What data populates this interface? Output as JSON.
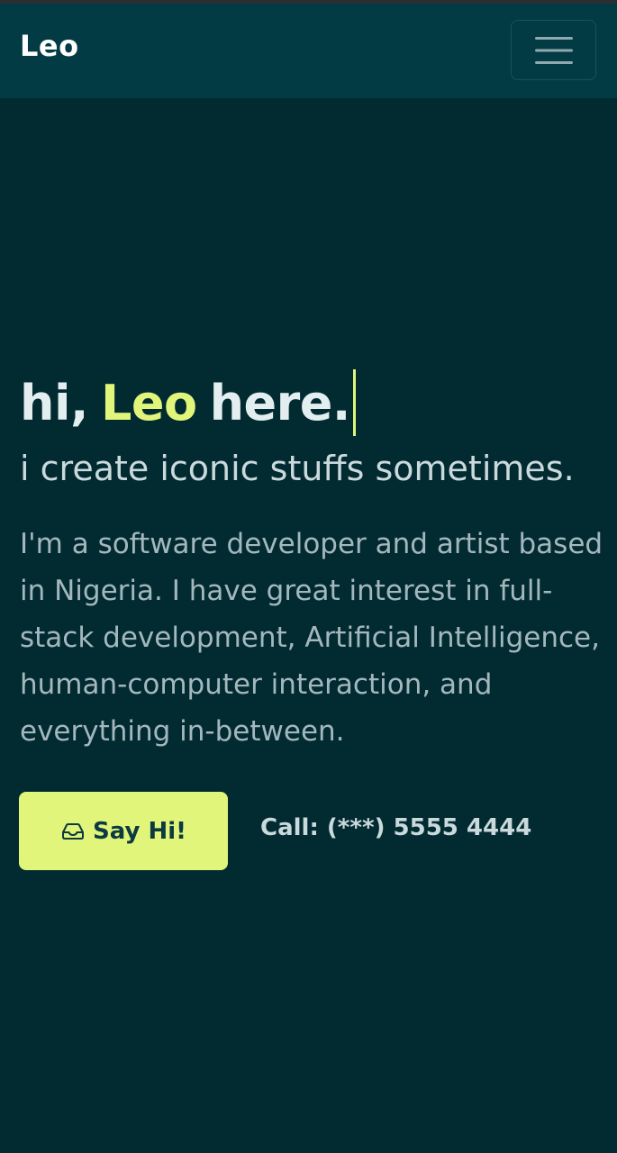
{
  "header": {
    "brand": "Leo",
    "menu_icon": "hamburger-menu-icon"
  },
  "hero": {
    "greeting_prefix": "hi,",
    "greeting_name": "Leo",
    "greeting_suffix": "here.",
    "subtitle": "i create iconic stuffs sometimes.",
    "bio": "I'm a software developer and artist based in Nigeria. I have great interest in full-stack development, Artificial Intelligence, human-computer interaction, and everything in-between."
  },
  "actions": {
    "cta_label": "Say Hi!",
    "cta_icon": "inbox-icon",
    "call_text": "Call: (***) 5555 4444"
  },
  "colors": {
    "background": "#022a31",
    "navbar": "#033b44",
    "accent": "#e0f57a",
    "heading": "#e3eef0",
    "body_text": "#a3b8bd"
  }
}
